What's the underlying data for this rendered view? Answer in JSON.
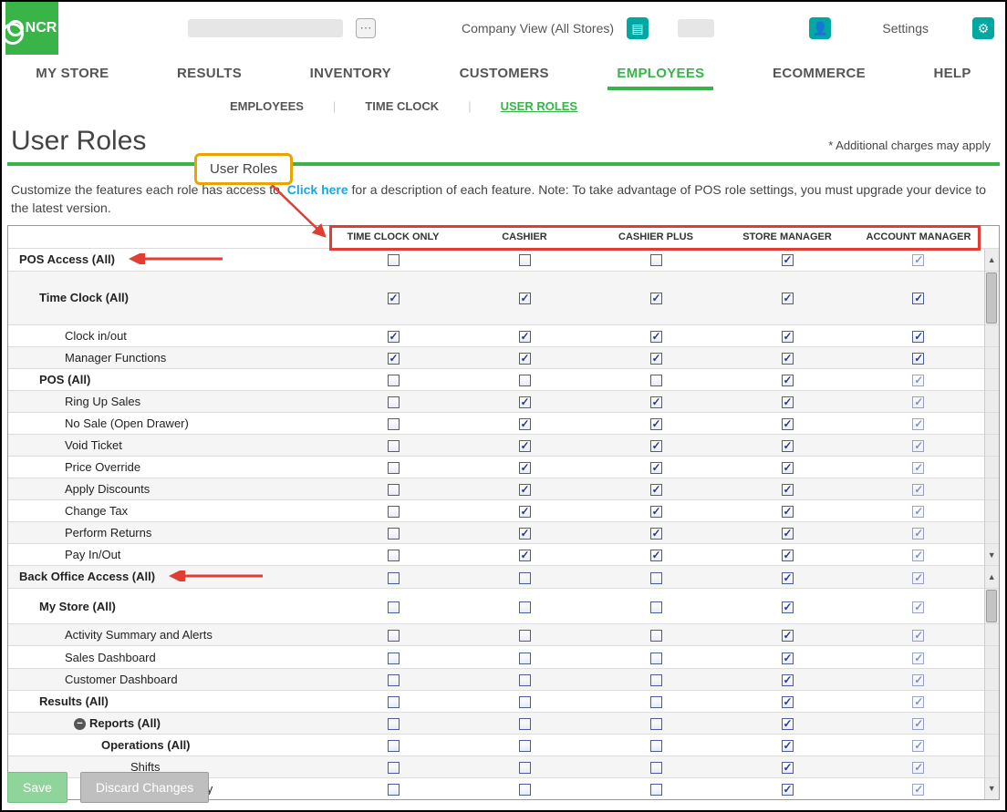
{
  "brand": "NCR",
  "top": {
    "company_view": "Company View (All Stores)",
    "settings": "Settings"
  },
  "mainnav": [
    "MY STORE",
    "RESULTS",
    "INVENTORY",
    "CUSTOMERS",
    "EMPLOYEES",
    "ECOMMERCE",
    "HELP"
  ],
  "mainnav_active": 4,
  "subnav": [
    "EMPLOYEES",
    "TIME CLOCK",
    "USER ROLES"
  ],
  "subnav_active": 2,
  "page_title": "User Roles",
  "charges_note": "* Additional charges may apply",
  "callout": "User Roles",
  "desc_pre": "Customize the features each role has access to. ",
  "desc_link": "Click here",
  "desc_post": " for a description of each feature. Note: To take advantage of POS role settings, you must upgrade your device to the latest version.",
  "columns": [
    "TIME CLOCK ONLY",
    "CASHIER",
    "CASHIER PLUS",
    "STORE MANAGER",
    "ACCOUNT MANAGER"
  ],
  "rows": [
    {
      "label": "POS Access (All)",
      "lvl": 0,
      "alt": false,
      "v": [
        0,
        0,
        0,
        1,
        2
      ],
      "arrow": true
    },
    {
      "label": "Time Clock (All)",
      "lvl": 1,
      "alt": true,
      "v": [
        1,
        1,
        1,
        1,
        1
      ]
    },
    {
      "label": "Clock in/out",
      "lvl": 2,
      "alt": false,
      "v": [
        1,
        1,
        1,
        1,
        1
      ]
    },
    {
      "label": "Manager Functions",
      "lvl": 2,
      "alt": true,
      "v": [
        1,
        1,
        1,
        1,
        1
      ]
    },
    {
      "label": "POS (All)",
      "lvl": 1,
      "alt": false,
      "v": [
        0,
        0,
        0,
        1,
        2
      ]
    },
    {
      "label": "Ring Up Sales",
      "lvl": 2,
      "alt": true,
      "v": [
        0,
        1,
        1,
        1,
        2
      ]
    },
    {
      "label": "No Sale (Open Drawer)",
      "lvl": 2,
      "alt": false,
      "v": [
        0,
        1,
        1,
        1,
        2
      ]
    },
    {
      "label": "Void Ticket",
      "lvl": 2,
      "alt": true,
      "v": [
        0,
        1,
        1,
        1,
        2
      ]
    },
    {
      "label": "Price Override",
      "lvl": 2,
      "alt": false,
      "v": [
        0,
        1,
        1,
        1,
        2
      ]
    },
    {
      "label": "Apply Discounts",
      "lvl": 2,
      "alt": true,
      "v": [
        0,
        1,
        1,
        1,
        2
      ]
    },
    {
      "label": "Change Tax",
      "lvl": 2,
      "alt": false,
      "v": [
        0,
        1,
        1,
        1,
        2
      ]
    },
    {
      "label": "Perform Returns",
      "lvl": 2,
      "alt": true,
      "v": [
        0,
        1,
        1,
        1,
        2
      ]
    },
    {
      "label": "Pay In/Out",
      "lvl": 2,
      "alt": false,
      "v": [
        0,
        1,
        1,
        1,
        2
      ]
    },
    {
      "label": "Back Office Access (All)",
      "lvl": 0,
      "alt": true,
      "v": [
        0,
        0,
        0,
        1,
        2
      ],
      "arrow": true
    },
    {
      "label": "My Store (All)",
      "lvl": 1,
      "alt": false,
      "v": [
        0,
        0,
        0,
        1,
        2
      ]
    },
    {
      "label": "Activity Summary and Alerts",
      "lvl": 2,
      "alt": true,
      "v": [
        0,
        0,
        0,
        1,
        2
      ]
    },
    {
      "label": "Sales Dashboard",
      "lvl": 2,
      "alt": false,
      "v": [
        0,
        0,
        0,
        1,
        2
      ]
    },
    {
      "label": "Customer Dashboard",
      "lvl": 2,
      "alt": true,
      "v": [
        0,
        0,
        0,
        1,
        2
      ]
    },
    {
      "label": "Results (All)",
      "lvl": 1,
      "alt": false,
      "v": [
        0,
        0,
        0,
        1,
        2
      ]
    },
    {
      "label": "Reports (All)",
      "lvl": 3,
      "alt": true,
      "v": [
        0,
        0,
        0,
        1,
        2
      ],
      "collapse": true
    },
    {
      "label": "Operations (All)",
      "lvl": 4,
      "alt": false,
      "v": [
        0,
        0,
        0,
        1,
        2
      ]
    },
    {
      "label": "Shifts",
      "lvl": 5,
      "alt": true,
      "v": [
        0,
        0,
        0,
        1,
        2
      ]
    },
    {
      "label": "Store Summary",
      "lvl": 5,
      "alt": false,
      "v": [
        0,
        0,
        0,
        1,
        2
      ]
    }
  ],
  "buttons": {
    "save": "Save",
    "discard": "Discard Changes"
  }
}
